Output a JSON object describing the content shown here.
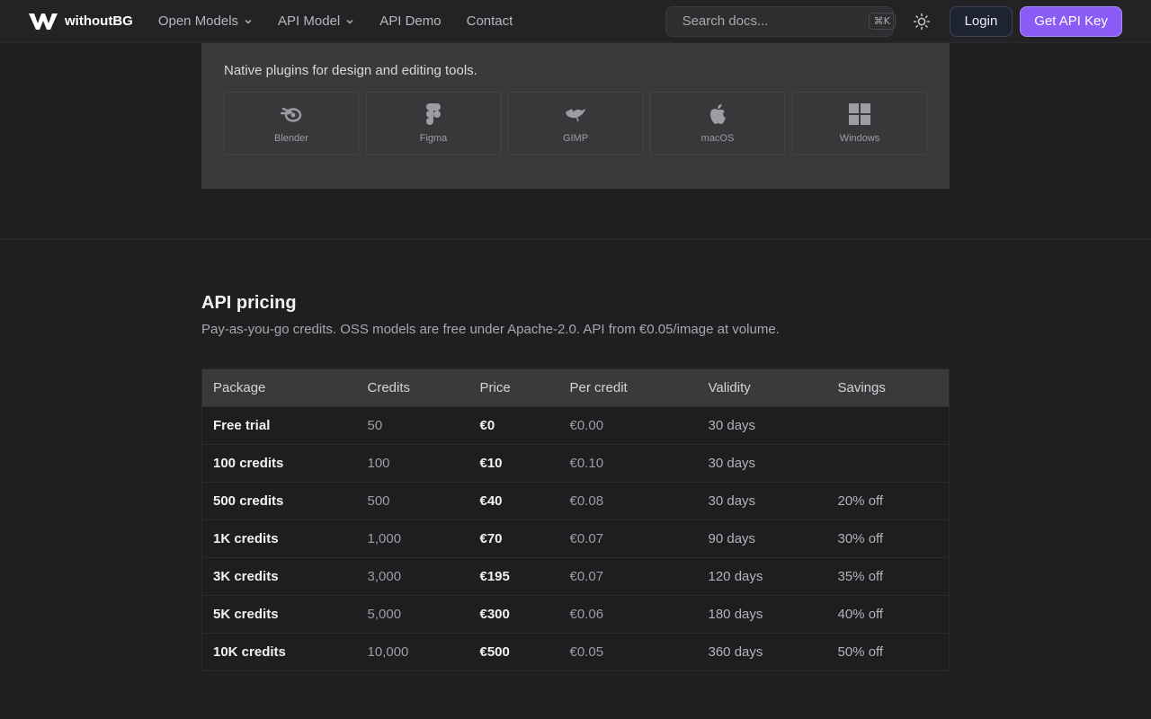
{
  "nav": {
    "brand": "withoutBG",
    "links": [
      {
        "label": "Open Models",
        "dropdown": true
      },
      {
        "label": "API Model",
        "dropdown": true
      },
      {
        "label": "API Demo",
        "dropdown": false
      },
      {
        "label": "Contact",
        "dropdown": false
      }
    ],
    "search_placeholder": "Search docs...",
    "search_shortcut": "⌘K",
    "login_label": "Login",
    "cta_label": "Get API Key",
    "accent_color": "#8b5cf6"
  },
  "plugins": {
    "description": "Native plugins for design and editing tools.",
    "tools": [
      {
        "label": "Blender",
        "icon": "blender-icon"
      },
      {
        "label": "Figma",
        "icon": "figma-icon"
      },
      {
        "label": "GIMP",
        "icon": "gimp-icon"
      },
      {
        "label": "macOS",
        "icon": "apple-icon"
      },
      {
        "label": "Windows",
        "icon": "windows-icon"
      }
    ]
  },
  "pricing": {
    "title": "API pricing",
    "subtitle": "Pay-as-you-go credits. OSS models are free under Apache-2.0. API from €0.05/image at volume.",
    "columns": [
      "Package",
      "Credits",
      "Price",
      "Per credit",
      "Validity",
      "Savings"
    ],
    "rows": [
      [
        "Free trial",
        "50",
        "€0",
        "€0.00",
        "30 days",
        ""
      ],
      [
        "100 credits",
        "100",
        "€10",
        "€0.10",
        "30 days",
        ""
      ],
      [
        "500 credits",
        "500",
        "€40",
        "€0.08",
        "30 days",
        "20% off"
      ],
      [
        "1K credits",
        "1,000",
        "€70",
        "€0.07",
        "90 days",
        "30% off"
      ],
      [
        "3K credits",
        "3,000",
        "€195",
        "€0.07",
        "120 days",
        "35% off"
      ],
      [
        "5K credits",
        "5,000",
        "€300",
        "€0.06",
        "180 days",
        "40% off"
      ],
      [
        "10K credits",
        "10,000",
        "€500",
        "€0.05",
        "360 days",
        "50% off"
      ]
    ]
  }
}
